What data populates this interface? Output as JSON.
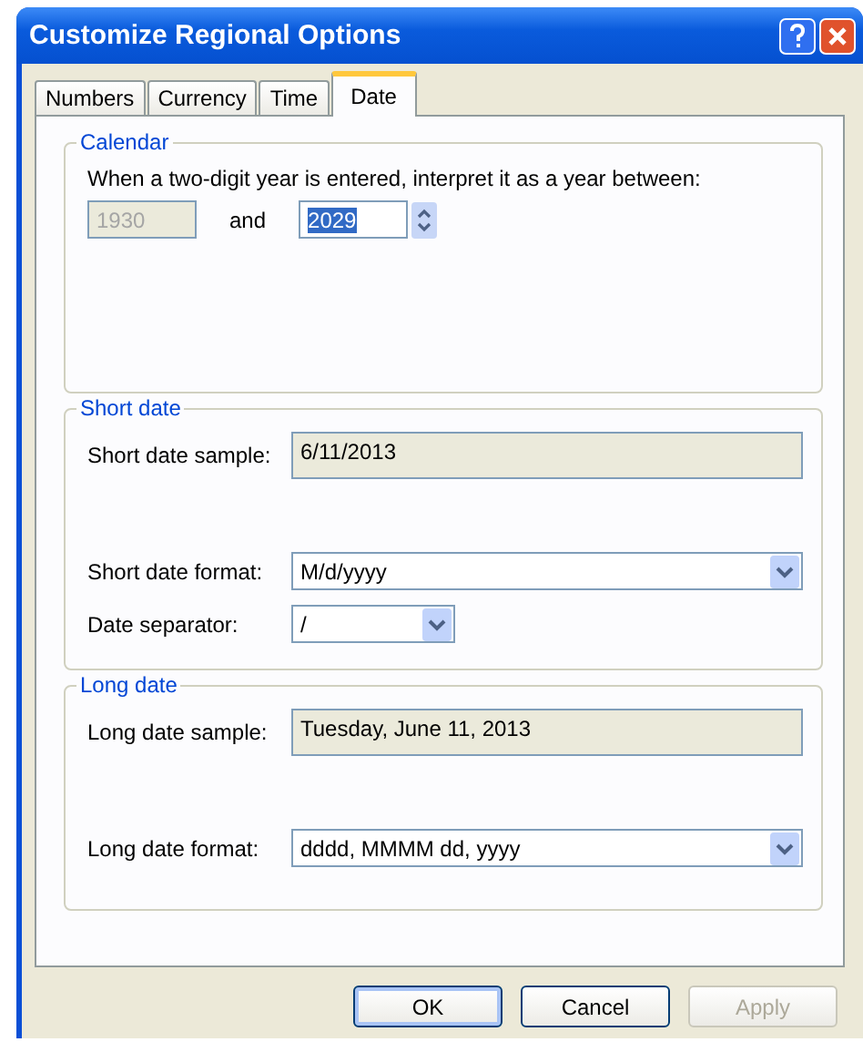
{
  "window": {
    "title": "Customize Regional Options"
  },
  "tabs": [
    {
      "label": "Numbers",
      "selected": false
    },
    {
      "label": "Currency",
      "selected": false
    },
    {
      "label": "Time",
      "selected": false
    },
    {
      "label": "Date",
      "selected": true
    }
  ],
  "calendar": {
    "title": "Calendar",
    "description": "When a two-digit year is entered, interpret it as a year between:",
    "from_year": {
      "value": "1930",
      "disabled": true
    },
    "connector": "and",
    "to_year": {
      "value": "2029",
      "highlighted": true
    }
  },
  "short_date": {
    "title": "Short date",
    "sample_label": "Short date sample:",
    "sample": "6/11/2013",
    "format_label": "Short date format:",
    "format": "M/d/yyyy",
    "separator_label": "Date separator:",
    "separator": "/"
  },
  "long_date": {
    "title": "Long date",
    "sample_label": "Long date sample:",
    "sample": "Tuesday, June 11, 2013",
    "format_label": "Long date format:",
    "format": "dddd, MMMM dd, yyyy"
  },
  "buttons": [
    {
      "label": "OK",
      "default": true,
      "disabled": false
    },
    {
      "label": "Cancel",
      "default": false,
      "disabled": false
    },
    {
      "label": "Apply",
      "default": false,
      "disabled": true
    }
  ]
}
